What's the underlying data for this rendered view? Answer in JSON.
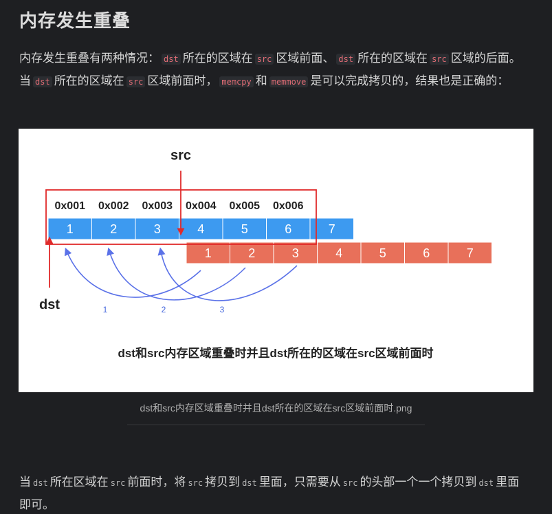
{
  "heading": "内存发生重叠",
  "intro": {
    "t1": "内存发生重叠有两种情况：",
    "c1": "dst",
    "t2": "所在的区域在",
    "c2": "src",
    "t3": "区域前面、",
    "c3": "dst",
    "t4": "所在的区域在",
    "c4": "src",
    "t5": "区域的后面。",
    "t6": "当",
    "c5": "dst",
    "t7": "所在的区域在",
    "c6": "src",
    "t8": "区域前面时，",
    "c7": "memcpy",
    "t9": "和",
    "c8": "memmove",
    "t10": "是可以完成拷贝的，结果也是正确的："
  },
  "figure": {
    "src_label": "src",
    "dst_label": "dst",
    "addresses": [
      "0x001",
      "0x002",
      "0x003",
      "0x004",
      "0x005",
      "0x006"
    ],
    "dst_cells": [
      "1",
      "2",
      "3",
      "4",
      "5",
      "6",
      "7"
    ],
    "src_cells": [
      "1",
      "2",
      "3",
      "4",
      "5",
      "6",
      "7"
    ],
    "arrow_labels": [
      "1",
      "2",
      "3"
    ],
    "bottom_title": "dst和src内存区域重叠时并且dst所在的区域在src区域前面时",
    "colors": {
      "blue": "#3d9af0",
      "orange": "#e8705a",
      "red": "#e02a2a",
      "arrow": "#5b72e8"
    }
  },
  "caption": "dst和src内存区域重叠时并且dst所在的区域在src区域前面时.png",
  "after": {
    "t1": "当",
    "c1": "dst",
    "t2": "所在区域在",
    "c2": "src",
    "t3": "前面时，将",
    "c3": "src",
    "t4": "拷贝到",
    "c4": "dst",
    "t5": "里面，只需要从",
    "c5": "src",
    "t6": "的头部一个一个拷贝到",
    "c6": "dst",
    "t7": "里面即可。"
  }
}
